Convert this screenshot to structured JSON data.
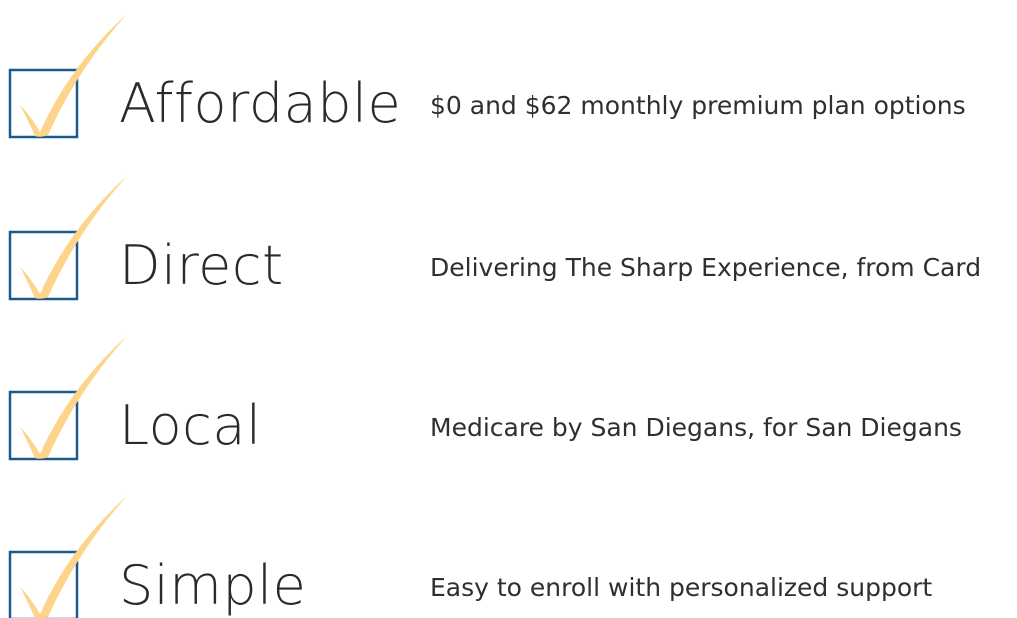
{
  "colors": {
    "box_border": "#1d5a8c",
    "check_mark": "#fdd48a",
    "heading_text": "#2a2a2a",
    "description_text": "#2f2f2f"
  },
  "features": [
    {
      "icon": "checkbox-checked-icon",
      "heading": "Affordable",
      "description": "$0 and $62 monthly premium plan options"
    },
    {
      "icon": "checkbox-checked-icon",
      "heading": "Direct",
      "description": "Delivering The Sharp Experience, from Card"
    },
    {
      "icon": "checkbox-checked-icon",
      "heading": "Local",
      "description": "Medicare by San Diegans, for San Diegans"
    },
    {
      "icon": "checkbox-checked-icon",
      "heading": "Simple",
      "description": "Easy to enroll with personalized support"
    }
  ]
}
